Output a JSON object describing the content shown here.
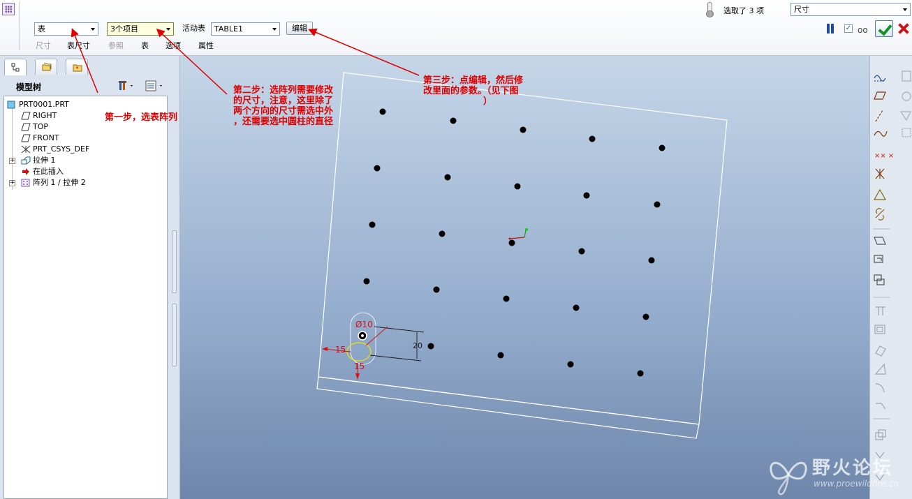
{
  "dashboard": {
    "type_select": "表",
    "items_select": "3个项目",
    "active_table_label": "活动表",
    "active_table_select": "TABLE1",
    "edit_button": "编辑",
    "tabs": [
      {
        "label": "尺寸",
        "enabled": false
      },
      {
        "label": "表尺寸",
        "enabled": true
      },
      {
        "label": "参照",
        "enabled": false
      },
      {
        "label": "表",
        "enabled": true
      },
      {
        "label": "选项",
        "enabled": true
      },
      {
        "label": "属性",
        "enabled": true
      }
    ],
    "selection_count": "选取了 3 项",
    "filter_select": "尺寸"
  },
  "navigator": {
    "title": "模型树",
    "tree": [
      {
        "label": "PRT0001.PRT",
        "icon": "part-icon"
      },
      {
        "label": "RIGHT",
        "icon": "datum-plane-icon"
      },
      {
        "label": "TOP",
        "icon": "datum-plane-icon"
      },
      {
        "label": "FRONT",
        "icon": "datum-plane-icon"
      },
      {
        "label": "PRT_CSYS_DEF",
        "icon": "csys-icon"
      },
      {
        "label": "拉伸 1",
        "icon": "extrude-icon"
      },
      {
        "label": "在此插入",
        "icon": "insert-here-icon"
      },
      {
        "label": "阵列 1 / 拉伸 2",
        "icon": "pattern-icon"
      }
    ]
  },
  "model": {
    "dim_diameter": "Ø10",
    "dim_spacing": "20",
    "dim_offset_left": "15",
    "dim_offset_bottom": "15"
  },
  "annotations": {
    "step1": "第一步，选表阵列",
    "step2": [
      "第二步：选阵列需要修改",
      "的尺寸，注意，这里除了",
      "两个方向的尺寸需选中外",
      "，还需要选中圆柱的直径"
    ],
    "step3": [
      "第三步：点编辑，然后修",
      "改里面的参数。（见下图",
      "）"
    ]
  },
  "watermark": {
    "title": "野火论坛",
    "url": "www.proewildfire.cn"
  },
  "colors": {
    "annotation": "#e00000",
    "dimension": "#d81010",
    "confirm": "#14902a",
    "cancel": "#c81414"
  }
}
